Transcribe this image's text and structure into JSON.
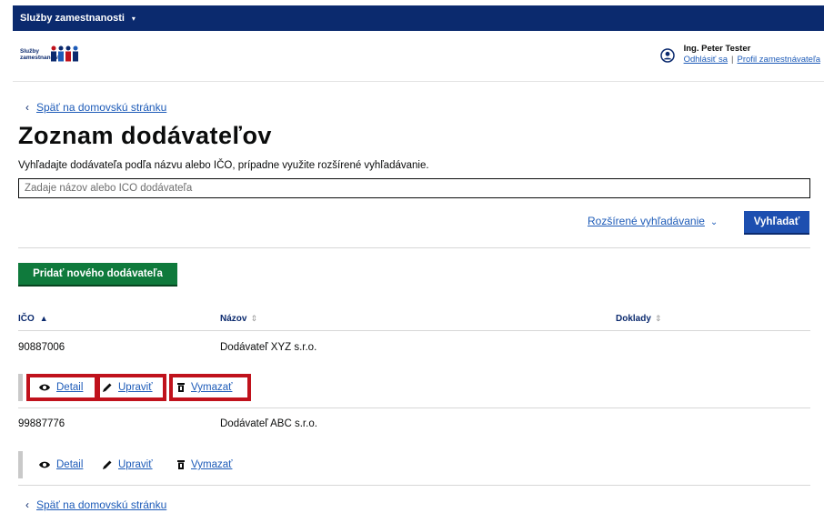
{
  "topbar": {
    "title": "Služby zamestnanosti",
    "caret": "▾"
  },
  "logo": {
    "line1": "Služby",
    "line2": "zamestnanosti"
  },
  "user": {
    "name": "Ing. Peter Tester",
    "logout": "Odhlásiť sa",
    "separator": "|",
    "profile": "Profil zamestnávateľa"
  },
  "back_link": {
    "arrow": "‹",
    "label": "Späť na domovskú stránku"
  },
  "page_title": "Zoznam dodávateľov",
  "hint": "Vyhľadajte dodávateľa podľa názvu alebo IČO, prípadne využite rozšírené vyhľadávanie.",
  "search": {
    "placeholder": "Zadaje názov alebo IČO dodávateľa"
  },
  "advanced_search": {
    "label": "Rozšírené vyhľadávanie",
    "chevron": "⌄"
  },
  "search_button": "Vyhľadať",
  "add_button": "Pridať nového dodávateľa",
  "table": {
    "columns": [
      {
        "label": "IČO",
        "sort": "▲"
      },
      {
        "label": "Názov",
        "sort": "⇕"
      },
      {
        "label": "Doklady",
        "sort": "⇕"
      }
    ],
    "rows": [
      {
        "ico": "90887006",
        "name": "Dodávateľ XYZ s.r.o."
      },
      {
        "ico": "99887776",
        "name": "Dodávateľ ABC s.r.o."
      }
    ],
    "actions": {
      "detail": "Detail",
      "edit": "Upraviť",
      "delete": "Vymazať"
    }
  },
  "colors": {
    "nav": "#0b2a6e",
    "link": "#1d5bb8",
    "primary": "#1d4fb0",
    "success": "#0f7a3c",
    "highlight": "#c0121c"
  }
}
